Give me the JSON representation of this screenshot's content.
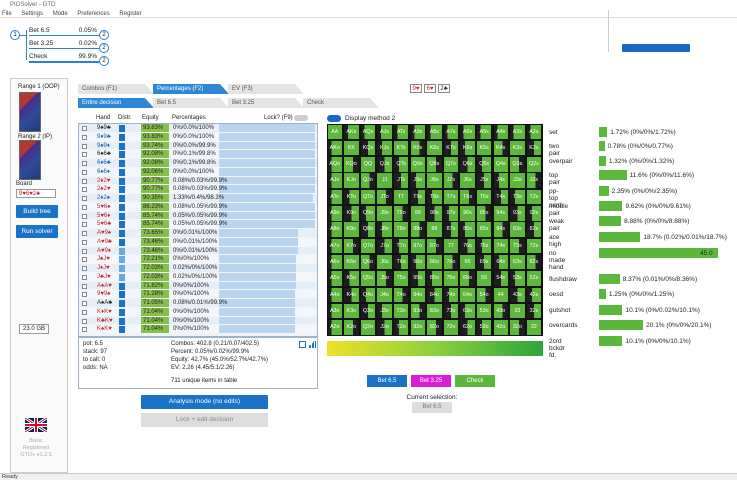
{
  "window": {
    "title": "PIOSolver - GTO",
    "status": "Ready"
  },
  "menu": [
    "File",
    "Settings",
    "Mode",
    "Preferences",
    "Register"
  ],
  "tree": {
    "root_node": "1",
    "actions": [
      {
        "label": "Bet 6.5",
        "pct": "0.05%",
        "node": "2"
      },
      {
        "label": "Bet 3.25",
        "pct": "0.02%",
        "node": "2"
      },
      {
        "label": "Check",
        "pct": "99.9%",
        "node": "2"
      }
    ]
  },
  "left": {
    "range1": "Range 1 (OOP)",
    "range2": "Range 2 (IP)",
    "board_label": "Board",
    "board_value": "9♥6♥2♣",
    "build_tree": "Build tree",
    "run_solver": "Run solver",
    "memory": "23.0 GB",
    "brand_lines": [
      "Basic",
      "Registered",
      "GTO+ v1.2.5"
    ]
  },
  "tabs_top": [
    "Combos (F1)",
    "Percentages (F2)",
    "EV (F3)"
  ],
  "tabs_sub": [
    "Entire decision",
    "Bet 6.5",
    "Bet 3.25",
    "Check"
  ],
  "table": {
    "headers": {
      "hand": "Hand",
      "distr": "Distr.",
      "equity": "Equity",
      "percentages": "Percentages",
      "lock": "Lock? (F9)"
    },
    "rows": [
      {
        "hand": "9♠9♣",
        "suit": "black",
        "equity": "93.83%",
        "pct": "0%/0.0%/100%",
        "fill": 1.0
      },
      {
        "hand": "9♦9♣",
        "suit": "blue",
        "equity": "93.83%",
        "pct": "0%/0.0%/100%",
        "fill": 1.0
      },
      {
        "hand": "9♠9♦",
        "suit": "blue",
        "equity": "93.74%",
        "pct": "0%/0.0%/99.9%",
        "fill": 1.0
      },
      {
        "hand": "6♠6♣",
        "suit": "black",
        "equity": "92.08%",
        "pct": "0%/0.1%/99.8%",
        "fill": 1.0
      },
      {
        "hand": "6♦6♣",
        "suit": "blue",
        "equity": "92.08%",
        "pct": "0%/0.1%/99.8%",
        "fill": 1.0
      },
      {
        "hand": "6♠6♦",
        "suit": "blue",
        "equity": "92.06%",
        "pct": "0%/0.0%/100%",
        "fill": 1.0
      },
      {
        "hand": "2♦2♥",
        "suit": "red",
        "equity": "90.77%",
        "pct": "0.08%/0.03%/99.9%",
        "fill": 1.0
      },
      {
        "hand": "2♠2♥",
        "suit": "red",
        "equity": "90.77%",
        "pct": "0.08%/0.03%/99.9%",
        "fill": 1.0
      },
      {
        "hand": "2♦2♠",
        "suit": "blue",
        "equity": "90.35%",
        "pct": "1.33%/0.4%/98.3%",
        "fill": 0.98
      },
      {
        "hand": "5♥6♠",
        "suit": "red",
        "equity": "86.23%",
        "pct": "0.08%/0.05%/99.9%",
        "fill": 1.0
      },
      {
        "hand": "5♥6♦",
        "suit": "red",
        "equity": "85.74%",
        "pct": "0.05%/0.05%/99.9%",
        "fill": 1.0
      },
      {
        "hand": "5♥6♣",
        "suit": "red",
        "equity": "85.74%",
        "pct": "0.05%/0.05%/99.9%",
        "fill": 1.0
      },
      {
        "hand": "A♥9♠",
        "suit": "red",
        "equity": "73.65%",
        "pct": "0%/0.01%/100%",
        "fill": 0.82
      },
      {
        "hand": "A♥9♣",
        "suit": "red",
        "equity": "73.46%",
        "pct": "0%/0.01%/100%",
        "fill": 0.82
      },
      {
        "hand": "A♥9♦",
        "suit": "red",
        "equity": "73.46%",
        "pct": "0%/0.01%/100%",
        "fill": 0.82
      },
      {
        "hand": "J♠J♥",
        "suit": "red",
        "equity": "72.21%",
        "pct": "0%/0%/100%",
        "fill": 0.8
      },
      {
        "hand": "J♦J♥",
        "suit": "red",
        "equity": "72.03%",
        "pct": "0.02%/0%/100%",
        "fill": 0.8
      },
      {
        "hand": "J♣J♥",
        "suit": "red",
        "equity": "72.03%",
        "pct": "0.02%/0%/100%",
        "fill": 0.8
      },
      {
        "hand": "A♠A♥",
        "suit": "red",
        "equity": "71.82%",
        "pct": "0%/0%/100%",
        "fill": 0.8
      },
      {
        "hand": "9♥9♠",
        "suit": "red",
        "equity": "71.28%",
        "pct": "0%/0%/100%",
        "fill": 0.79
      },
      {
        "hand": "A♠A♣",
        "suit": "black",
        "equity": "71.05%",
        "pct": "0.08%/0.01%/99.9%",
        "fill": 0.79
      },
      {
        "hand": "K♦K♥",
        "suit": "red",
        "equity": "71.04%",
        "pct": "0%/0%/100%",
        "fill": 0.79
      },
      {
        "hand": "K♣K♥",
        "suit": "red",
        "equity": "71.04%",
        "pct": "0%/0%/100%",
        "fill": 0.79
      },
      {
        "hand": "K♠K♥",
        "suit": "red",
        "equity": "71.04%",
        "pct": "0%/0%/100%",
        "fill": 0.79
      }
    ]
  },
  "info": {
    "pot": "pot: 6.5",
    "stack": "stack: 97",
    "to_call": "to call: 0",
    "odds": "odds: NA",
    "combos": "Combos: 402.8 (0.21/0.07/402.5)",
    "percent": "Percent:  0.05%/0.02%/99.9%",
    "equity": "Equity:  42.7% (45.0%/52.7%/42.7%)",
    "ev": "EV:  2.26 (4.45/5.1/2.26)",
    "unique": "711 unique items in table"
  },
  "analysis_button": "Analysis mode (no edits)",
  "lock_button": "Lock + edit decision",
  "board_cards": [
    {
      "card": "9♥",
      "color": "red"
    },
    {
      "card": "6♥",
      "color": "red"
    },
    {
      "card": "2♣",
      "color": "black"
    }
  ],
  "display_method": "Display method 2",
  "grid_ranks": [
    "A",
    "K",
    "Q",
    "J",
    "T",
    "9",
    "8",
    "7",
    "6",
    "5",
    "4",
    "3",
    "2"
  ],
  "stats": [
    {
      "label": "set",
      "value": "1.72% (0%/0%/1.72%)",
      "fill": 0.06
    },
    {
      "label": "two pair",
      "value": "0.78% (0%/0%/0.77%)",
      "fill": 0.04
    },
    {
      "label": "overpair",
      "value": "1.32% (0%/0%/1.32%)",
      "fill": 0.05
    },
    {
      "label": "top pair",
      "value": "11.6% (0%/0%/11.6%)",
      "fill": 0.2
    },
    {
      "label": "pp-top card",
      "value": "2.35% (0%/0%/2.35%)",
      "fill": 0.07
    },
    {
      "label": "middle pair",
      "value": "9.62% (0%/0%/9.61%)",
      "fill": 0.17
    },
    {
      "label": "weak pair",
      "value": "8.88% (0%/0%/8.88%)",
      "fill": 0.16
    },
    {
      "label": "ace high",
      "value": "18.7% (0.02%/0.01%/18.7%)",
      "fill": 0.3
    },
    {
      "label": "no made hand",
      "value": "45.0",
      "fill": 0.86
    },
    {
      "label": "flushdraw",
      "value": "8.37% (0.01%/0%/8.36%)",
      "fill": 0.15
    },
    {
      "label": "oesd",
      "value": "1.25% (0%/0%/1.25%)",
      "fill": 0.05
    },
    {
      "label": "gutshot",
      "value": "10.1% (0%/0.02%/10.1%)",
      "fill": 0.17
    },
    {
      "label": "overcards",
      "value": "20.1% (0%/0%/20.1%)",
      "fill": 0.32
    },
    {
      "label": "2crd bckdr fd.",
      "value": "10.1% (0%/0%/10.1%)",
      "fill": 0.17
    }
  ],
  "action_buttons": [
    {
      "label": "Bet 6.5",
      "color": "#1a73c6"
    },
    {
      "label": "Bet 3.25",
      "color": "#d81fd8"
    },
    {
      "label": "Check",
      "color": "#5cb83a"
    }
  ],
  "current_selection": {
    "label": "Current selection:",
    "value": "Bet 6.5"
  }
}
